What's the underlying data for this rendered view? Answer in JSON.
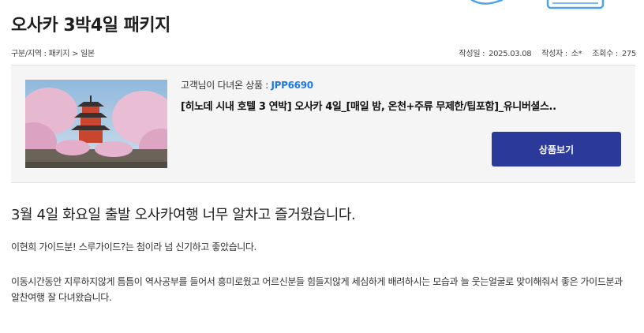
{
  "page": {
    "title": "오사카 3박4일 패키지"
  },
  "breadcrumb": "구분/지역 : 패키지 > 일본",
  "meta": {
    "date_label": "작성일 :",
    "date": "2025.03.08",
    "author_label": "작성자 :",
    "author": "소*",
    "views_label": "조회수 :",
    "views": "275"
  },
  "product": {
    "code_label": "고객님이 다녀온 상품 :",
    "code": "JPP6690",
    "name": "[히노데 시내 호텔 3 연박] 오사카 4일_[매일 밤, 온천+주류 무제한/팁포함]_유니버셜스..",
    "button_label": "상품보기",
    "image_icon": "pagoda-cherry-blossom-photo"
  },
  "post": {
    "heading": "3월 4일 화요일 출발 오사카여행 너무 알차고 즐거웠습니다.",
    "paragraphs": [
      "이현희 가이드분! 스루가이드?는 첨이라 넘 신기하고 좋았습니다.",
      "이동시간동안 지루하지않게 틈틈이 역사공부를 들어서 흥미로웠고 어르신분들 힘들지않게 세심하게 배려하시는 모습과 늘 웃는얼굴로 맞이해줘서 좋은 가이드분과 알찬여행 잘 다녀왔습니다."
    ]
  },
  "colors": {
    "accent": "#1f7ae0",
    "button": "#2b3a9a",
    "panel": "#f5f5f5"
  }
}
